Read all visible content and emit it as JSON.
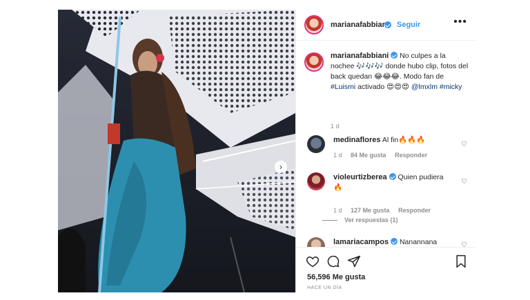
{
  "post_header": {
    "username": "marianafabbiani",
    "follow_label": "Seguir",
    "separator": "•",
    "more_icon": "ellipsis-icon"
  },
  "caption": {
    "username": "marianafabbiani",
    "text_before": "No culpes a la nochee 🎶🎶🎶 donde hubo clip, fotos del back quedan 😂😂😂. Modo fan de ",
    "hashtag_1": "#Luismi",
    "text_after": " activado 😍😍😍 ",
    "mention": "@lmxlm",
    "hashtag_2": "#micky",
    "time": "1 d"
  },
  "comments": [
    {
      "username": "medinaflores",
      "text": "Al fin🔥🔥🔥",
      "time": "1 d",
      "likes": "84 Me gusta",
      "reply": "Responder",
      "verified": false
    },
    {
      "username": "violeurtizberea",
      "text": "Quien pudiera 🔥",
      "time": "1 d",
      "likes": "127 Me gusta",
      "reply": "Responder",
      "verified": true
    },
    {
      "username": "lamariacampos",
      "text": "Nanannana",
      "verified": true
    }
  ],
  "view_replies": "Ver respuestas (1)",
  "actions": {
    "likes": "56,596 Me gusta",
    "time_ago": "HACE UN DÍA"
  },
  "colors": {
    "accent": "#3897f0",
    "text": "#262626",
    "muted": "#8e8e8e",
    "link": "#00376b"
  }
}
